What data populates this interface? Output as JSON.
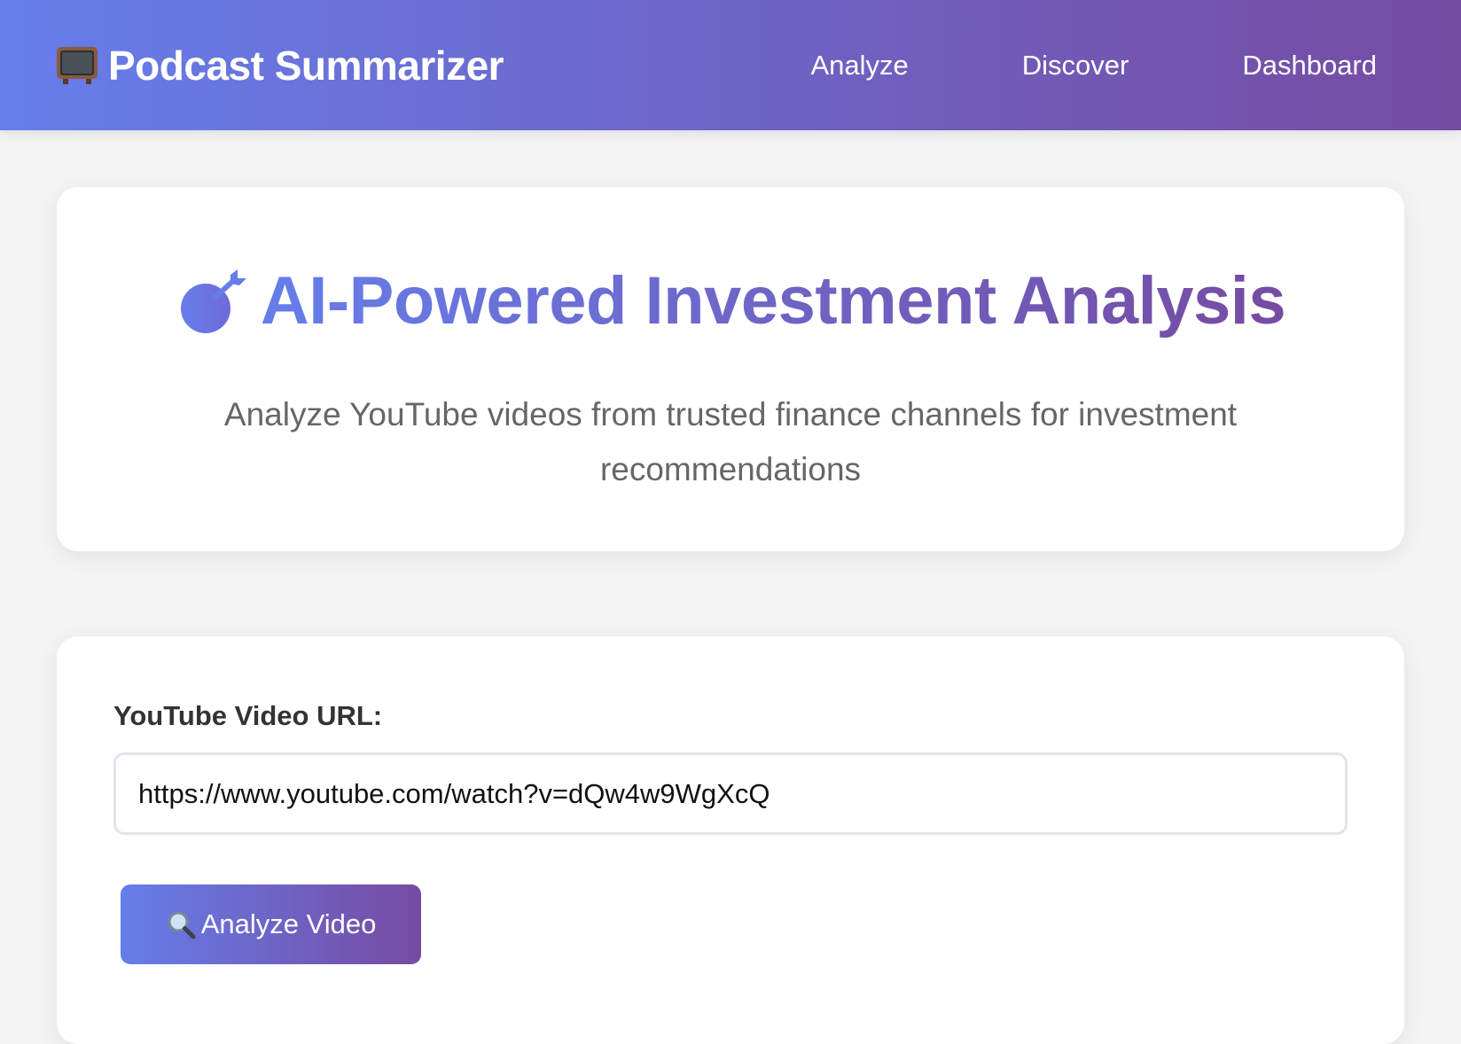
{
  "header": {
    "brand_icon": "television-icon",
    "brand_title": "Podcast Summarizer",
    "nav": [
      {
        "label": "Analyze"
      },
      {
        "label": "Discover"
      },
      {
        "label": "Dashboard"
      }
    ],
    "gradient": [
      "#667eea",
      "#764ba2"
    ]
  },
  "hero": {
    "icon": "dart-target-icon",
    "title": "AI-Powered Investment Analysis",
    "subtitle": "Analyze YouTube videos from trusted finance channels for investment recommendations"
  },
  "form": {
    "url_label": "YouTube Video URL:",
    "url_value": "https://www.youtube.com/watch?v=dQw4w9WgXcQ",
    "submit_icon": "magnifier-icon",
    "submit_label": "Analyze Video"
  }
}
